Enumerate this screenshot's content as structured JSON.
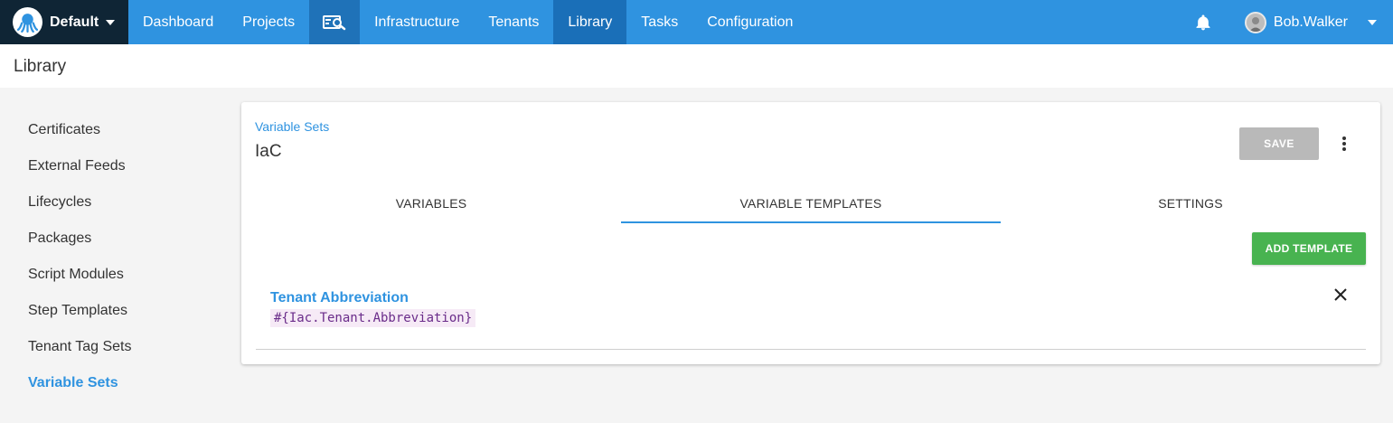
{
  "topnav": {
    "space_name": "Default",
    "items": [
      "Dashboard",
      "Projects",
      "Infrastructure",
      "Tenants",
      "Library",
      "Tasks",
      "Configuration"
    ],
    "active": "Library",
    "search_icon": "search-in-window-icon",
    "user_name": "Bob.Walker"
  },
  "page": {
    "title": "Library"
  },
  "sidebar": {
    "items": [
      "Certificates",
      "External Feeds",
      "Lifecycles",
      "Packages",
      "Script Modules",
      "Step Templates",
      "Tenant Tag Sets",
      "Variable Sets"
    ],
    "active": "Variable Sets"
  },
  "card": {
    "breadcrumb": "Variable Sets",
    "title": "IaC",
    "save_label": "SAVE",
    "tabs": [
      "VARIABLES",
      "VARIABLE TEMPLATES",
      "SETTINGS"
    ],
    "active_tab": "VARIABLE TEMPLATES",
    "add_template_label": "ADD TEMPLATE",
    "templates": [
      {
        "name": "Tenant Abbreviation",
        "variable": "#{Iac.Tenant.Abbreviation}"
      }
    ]
  },
  "colors": {
    "nav_blue": "#2f93e0",
    "nav_dark": "#0f2535",
    "active_nav": "#1a6fb8",
    "green": "#48b350",
    "save_disabled": "#b9b9b9"
  }
}
